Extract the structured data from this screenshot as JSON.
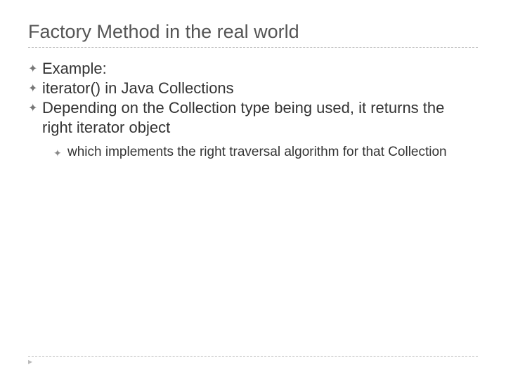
{
  "slide": {
    "title": "Factory Method in the real world",
    "bullets": [
      {
        "text": "Example:"
      },
      {
        "text": "iterator() in Java Collections"
      },
      {
        "text": "Depending on the Collection type being used, it returns the right iterator object"
      }
    ],
    "sub_bullets": [
      {
        "text": "which implements the right traversal algorithm for that Collection"
      }
    ],
    "bullet_glyph": "✦",
    "footer_glyph": "▸"
  }
}
